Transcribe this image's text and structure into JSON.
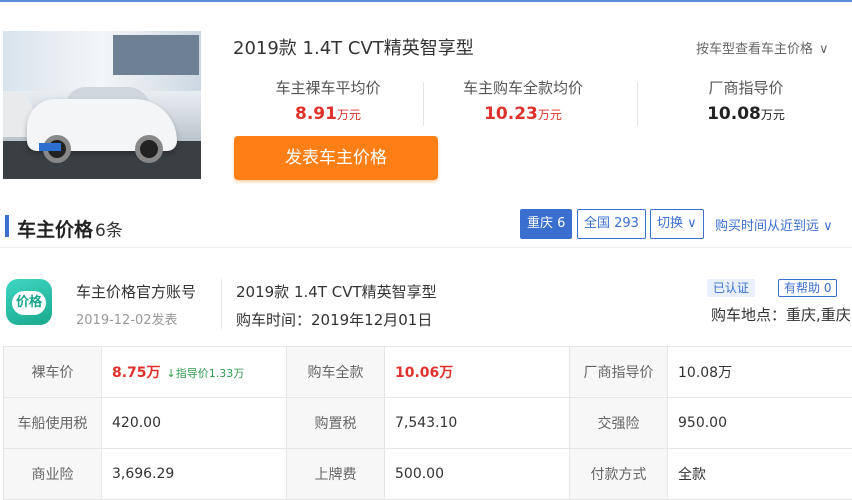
{
  "summary": {
    "model_title": "2019款 1.4T CVT精英智享型",
    "view_by_model": "按车型查看车主价格",
    "stats": [
      {
        "label": "车主裸车平均价",
        "value": "8.91",
        "unit": "万元"
      },
      {
        "label": "车主购车全款均价",
        "value": "10.23",
        "unit": "万元"
      },
      {
        "label": "厂商指导价",
        "value": "10.08",
        "unit": "万元"
      }
    ],
    "post_price_button": "发表车主价格"
  },
  "section": {
    "title": "车主价格",
    "count": "6条",
    "city_filter": "重庆 6",
    "all_filter": "全国 293",
    "switch_label": "切换",
    "sort_label": "购买时间从近到远"
  },
  "entry": {
    "avatar_badge": "价格",
    "owner_name": "车主价格官方账号",
    "post_date": "2019-12-02发表",
    "model": "2019款 1.4T CVT精英智享型",
    "buy_time": "购车时间：2019年12月01日",
    "verified_tag": "已认证",
    "helpful_tag": "有帮助 0",
    "buy_place": "购车地点：重庆,重庆"
  },
  "cost_table": {
    "rows": [
      [
        {
          "label": "裸车价",
          "value": "8.75万",
          "note": "↓指导价1.33万",
          "highlight": true
        },
        {
          "label": "购车全款",
          "value": "10.06万",
          "highlight": true
        },
        {
          "label": "厂商指导价",
          "value": "10.08万"
        }
      ],
      [
        {
          "label": "车船使用税",
          "value": "420.00"
        },
        {
          "label": "购置税",
          "value": "7,543.10"
        },
        {
          "label": "交强险",
          "value": "950.00"
        }
      ],
      [
        {
          "label": "商业险",
          "value": "3,696.29"
        },
        {
          "label": "上牌费",
          "value": "500.00"
        },
        {
          "label": "付款方式",
          "value": "全款"
        }
      ]
    ]
  },
  "colors": {
    "accent_blue": "#3a6fcf",
    "price_red": "#e0322c",
    "button_orange": "#ff7f17",
    "diff_green": "#2e9b4f"
  }
}
